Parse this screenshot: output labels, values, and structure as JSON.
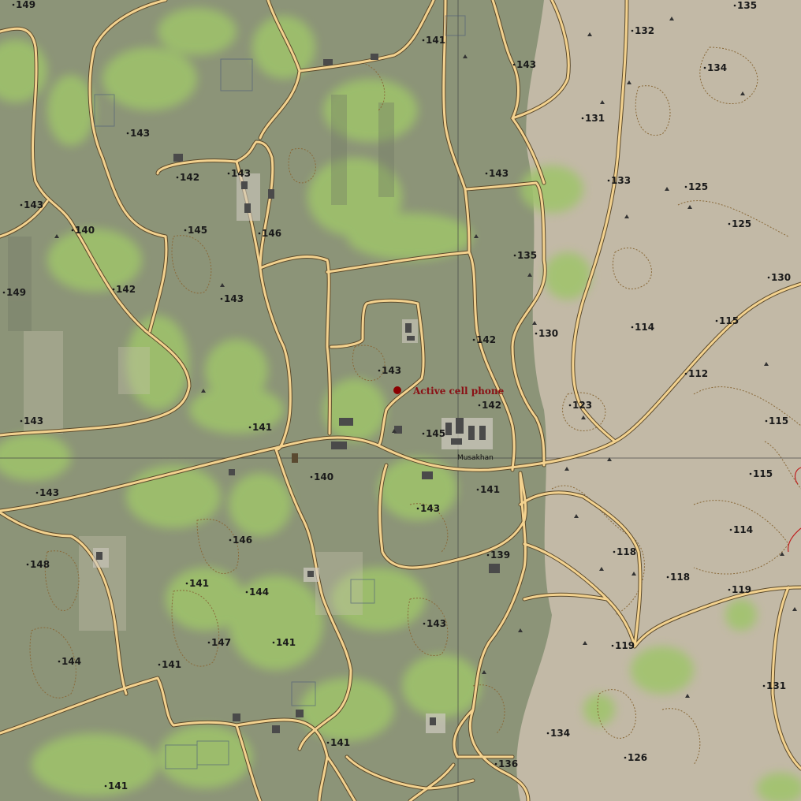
{
  "map": {
    "place_name": "Musakhan",
    "marker": {
      "label": "Active cell phone",
      "color": "#8b0000"
    },
    "elevation_labels": [
      "149",
      "135",
      "141",
      "132",
      "143",
      "134",
      "143",
      "131",
      "142",
      "143",
      "143",
      "133",
      "125",
      "143",
      "140",
      "145",
      "146",
      "125",
      "135",
      "130",
      "149",
      "142",
      "143",
      "114",
      "115",
      "142",
      "130",
      "143",
      "112",
      "141",
      "123",
      "143",
      "142",
      "115",
      "145",
      "140",
      "141",
      "115",
      "143",
      "143",
      "146",
      "148",
      "114",
      "139",
      "118",
      "141",
      "144",
      "118",
      "119",
      "143",
      "147",
      "141",
      "119",
      "144",
      "141",
      "141",
      "131",
      "134",
      "126",
      "136",
      "141"
    ],
    "colors": {
      "farmland": "#8c9478",
      "vegetation": "#9fc46a",
      "desert": "#c2b9a6",
      "road": "#f3d28f",
      "road_outline": "#5b4a2c",
      "contour": "#8a6a3a",
      "grid": "#444444"
    }
  }
}
